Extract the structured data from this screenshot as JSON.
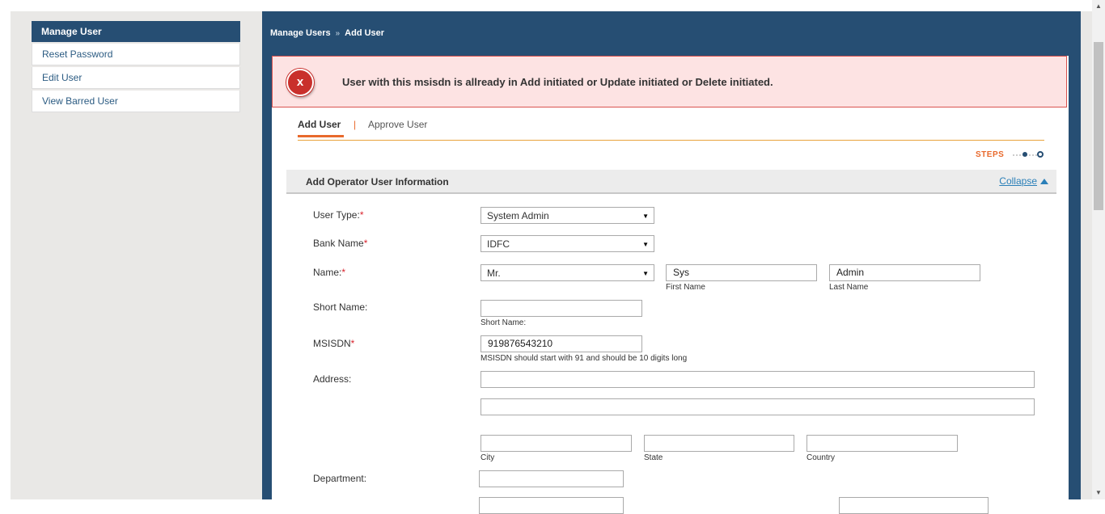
{
  "sidebar": {
    "header": "Manage User",
    "items": [
      "Reset Password",
      "Edit User",
      "View Barred User"
    ]
  },
  "breadcrumb": {
    "parent": "Manage Users",
    "separator": "»",
    "current": "Add User"
  },
  "alert": {
    "icon": "error-x-icon",
    "message": "User with this msisdn is allready in Add initiated or Update initiated or Delete initiated."
  },
  "tabs": {
    "active": "Add User",
    "other": "Approve User"
  },
  "steps": {
    "label": "STEPS"
  },
  "section": {
    "title": "Add Operator User Information",
    "collapse": "Collapse"
  },
  "form": {
    "user_type": {
      "label": "User Type:",
      "value": "System Admin"
    },
    "bank_name": {
      "label": "Bank Name",
      "value": "IDFC"
    },
    "name": {
      "label": "Name:",
      "title_value": "Mr.",
      "first_value": "Sys",
      "first_hint": "First Name",
      "last_value": "Admin",
      "last_hint": "Last Name"
    },
    "short_name": {
      "label": "Short Name:",
      "value": "",
      "hint": "Short Name:"
    },
    "msisdn": {
      "label": "MSISDN",
      "value": "919876543210",
      "hint": "MSISDN should start with 91 and should be 10 digits long"
    },
    "address": {
      "label": "Address:",
      "line1": "",
      "line2": "",
      "city_hint": "City",
      "state_hint": "State",
      "country_hint": "Country"
    },
    "department": {
      "label": "Department:",
      "value": ""
    }
  },
  "colors": {
    "sidebar_header": "#264e73",
    "main_bg": "#264e73",
    "alert_bg": "#fde3e3",
    "accent": "#e8692c",
    "link": "#2a7fb8"
  }
}
